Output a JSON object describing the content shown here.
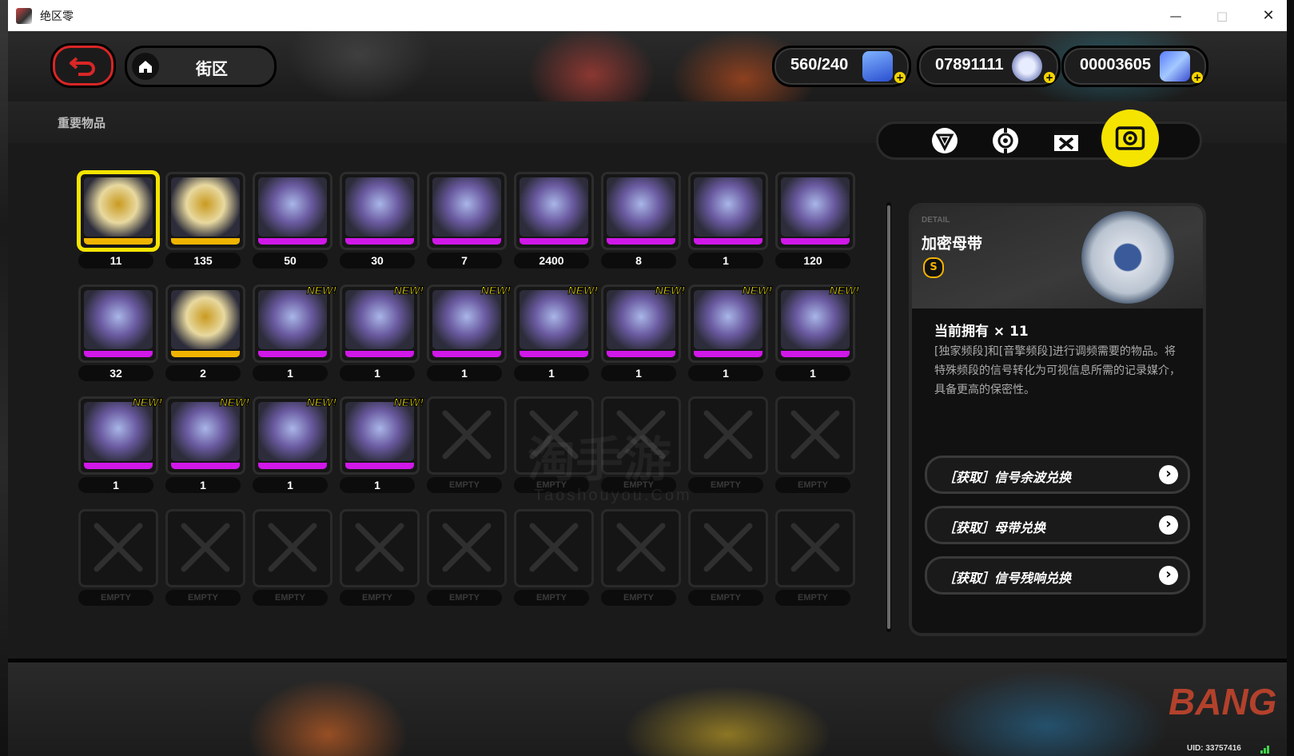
{
  "window": {
    "title": "绝区零"
  },
  "header": {
    "breadcrumb": "街区",
    "currencies": [
      {
        "value": "560/240",
        "icon": "battery-charge-icon"
      },
      {
        "value": "07891111",
        "icon": "denny-coin-icon"
      },
      {
        "value": "00003605",
        "icon": "polychrome-film-icon"
      }
    ]
  },
  "panel": {
    "title": "重要物品",
    "tabs": [
      {
        "icon": "triangle-emblem-icon",
        "active": false
      },
      {
        "icon": "reel-icon",
        "active": false
      },
      {
        "icon": "crate-icon",
        "active": false
      },
      {
        "icon": "tape-icon",
        "active": true
      }
    ],
    "new_tag": "NEW!",
    "empty_label": "EMPTY",
    "items": [
      {
        "count": "11",
        "rarity": "gold",
        "is_new": false,
        "selected": true,
        "icon": "encrypted-master-tape-icon"
      },
      {
        "count": "135",
        "rarity": "gold",
        "is_new": false,
        "selected": false,
        "icon": "bangboo-pedestal-icon"
      },
      {
        "count": "50",
        "rarity": "purple",
        "is_new": false,
        "selected": false,
        "icon": "gold-box-icon"
      },
      {
        "count": "30",
        "rarity": "purple",
        "is_new": false,
        "selected": false,
        "icon": "gear-part-icon"
      },
      {
        "count": "7",
        "rarity": "purple",
        "is_new": false,
        "selected": false,
        "icon": "dice-card-icon"
      },
      {
        "count": "2400",
        "rarity": "purple",
        "is_new": false,
        "selected": false,
        "icon": "battery-crate-icon"
      },
      {
        "count": "8",
        "rarity": "purple",
        "is_new": false,
        "selected": false,
        "icon": "ornate-card-icon"
      },
      {
        "count": "1",
        "rarity": "purple",
        "is_new": false,
        "selected": false,
        "icon": "blue-ticket-icon"
      },
      {
        "count": "120",
        "rarity": "purple",
        "is_new": false,
        "selected": false,
        "icon": "purple-chip-icon"
      },
      {
        "count": "32",
        "rarity": "purple",
        "is_new": false,
        "selected": false,
        "icon": "rca-tape-icon"
      },
      {
        "count": "2",
        "rarity": "gold",
        "is_new": false,
        "selected": false,
        "icon": "gold-statue-icon"
      },
      {
        "count": "1",
        "rarity": "purple",
        "is_new": true,
        "selected": false,
        "icon": "cat-sticker-icon"
      },
      {
        "count": "1",
        "rarity": "purple",
        "is_new": true,
        "selected": false,
        "icon": "cat-sticker-icon"
      },
      {
        "count": "1",
        "rarity": "purple",
        "is_new": true,
        "selected": false,
        "icon": "cat-sunglasses-icon"
      },
      {
        "count": "1",
        "rarity": "purple",
        "is_new": true,
        "selected": false,
        "icon": "lucky-cat-icon"
      },
      {
        "count": "1",
        "rarity": "purple",
        "is_new": true,
        "selected": false,
        "icon": "cat-box-icon"
      },
      {
        "count": "1",
        "rarity": "purple",
        "is_new": true,
        "selected": false,
        "icon": "flower-card-icon"
      },
      {
        "count": "1",
        "rarity": "purple",
        "is_new": true,
        "selected": false,
        "icon": "flower-card-icon"
      },
      {
        "count": "1",
        "rarity": "purple",
        "is_new": true,
        "selected": false,
        "icon": "flower-card-icon"
      },
      {
        "count": "1",
        "rarity": "purple",
        "is_new": true,
        "selected": false,
        "icon": "flower-card-icon"
      },
      {
        "count": "1",
        "rarity": "purple",
        "is_new": true,
        "selected": false,
        "icon": "striped-cat-icon"
      },
      {
        "count": "1",
        "rarity": "purple",
        "is_new": true,
        "selected": false,
        "icon": "paper-notes-icon"
      }
    ],
    "empty_slot_total": 14
  },
  "detail": {
    "tag": "DETAIL",
    "name": "加密母带",
    "rank": "S",
    "owned": "当前拥有 × 11",
    "description": "[独家频段]和[音擎频段]进行调频需要的物品。将特殊频段的信号转化为可视信息所需的记录媒介，具备更高的保密性。",
    "actions": [
      {
        "label": "［获取］信号余波兑换"
      },
      {
        "label": "［获取］母带兑换"
      },
      {
        "label": "［获取］信号残响兑换"
      }
    ]
  },
  "footer": {
    "uid": "UID: 33757416",
    "bg_text": "BANG"
  },
  "watermark": {
    "text": "淘手游",
    "sub": "Taoshouyou.Com"
  },
  "colors": {
    "gold": "#f0b400",
    "purple": "#d018e8",
    "accent": "#f5e400",
    "back_red": "#d92626"
  }
}
